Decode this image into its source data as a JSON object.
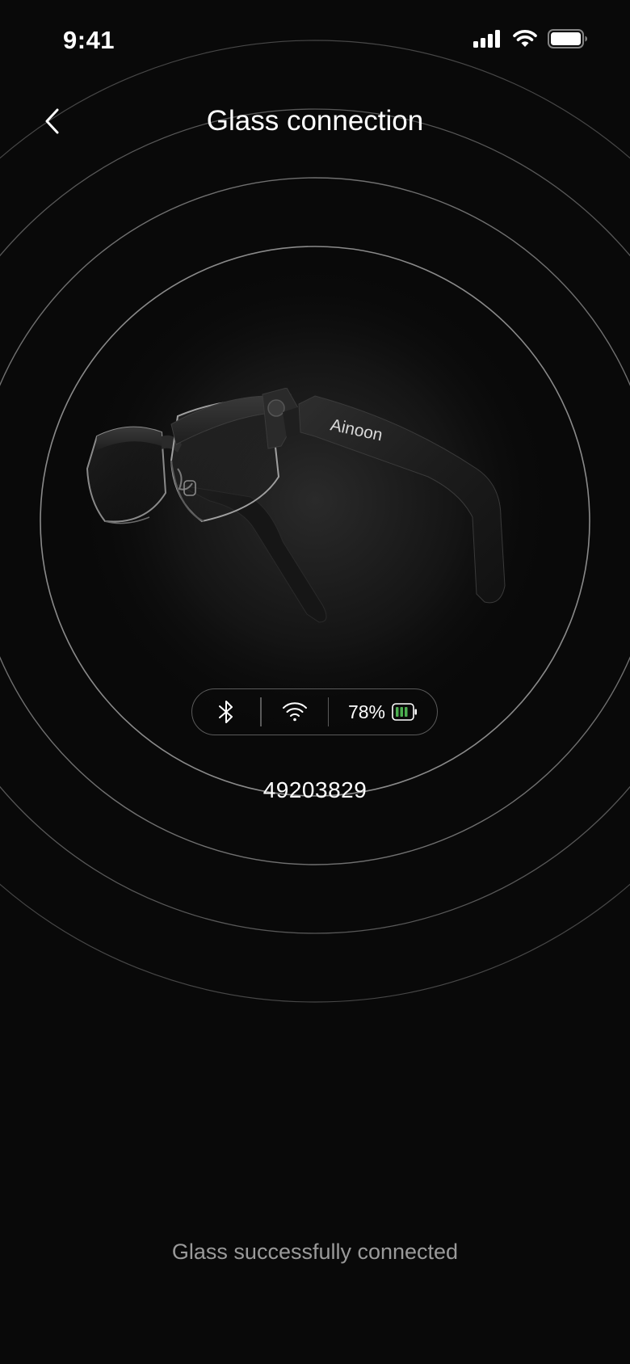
{
  "status_bar": {
    "time": "9:41",
    "icons": [
      "cellular-signal-icon",
      "wifi-icon",
      "battery-icon"
    ]
  },
  "header": {
    "back_icon": "chevron-left-icon",
    "title": "Glass connection"
  },
  "device": {
    "brand_logo_text": "Ainoon",
    "connection_status": {
      "bluetooth_icon": "bluetooth-icon",
      "wifi_icon": "wifi-icon",
      "battery_percent": "78%",
      "battery_icon": "battery-icon"
    },
    "id": "49203829"
  },
  "footer": {
    "status_message": "Glass successfully connected"
  },
  "colors": {
    "background": "#090909",
    "text_primary": "#ffffff",
    "text_secondary": "#9a9a9a",
    "ring_stroke": "#6b6b6b",
    "battery_fill": "#4caf50"
  }
}
